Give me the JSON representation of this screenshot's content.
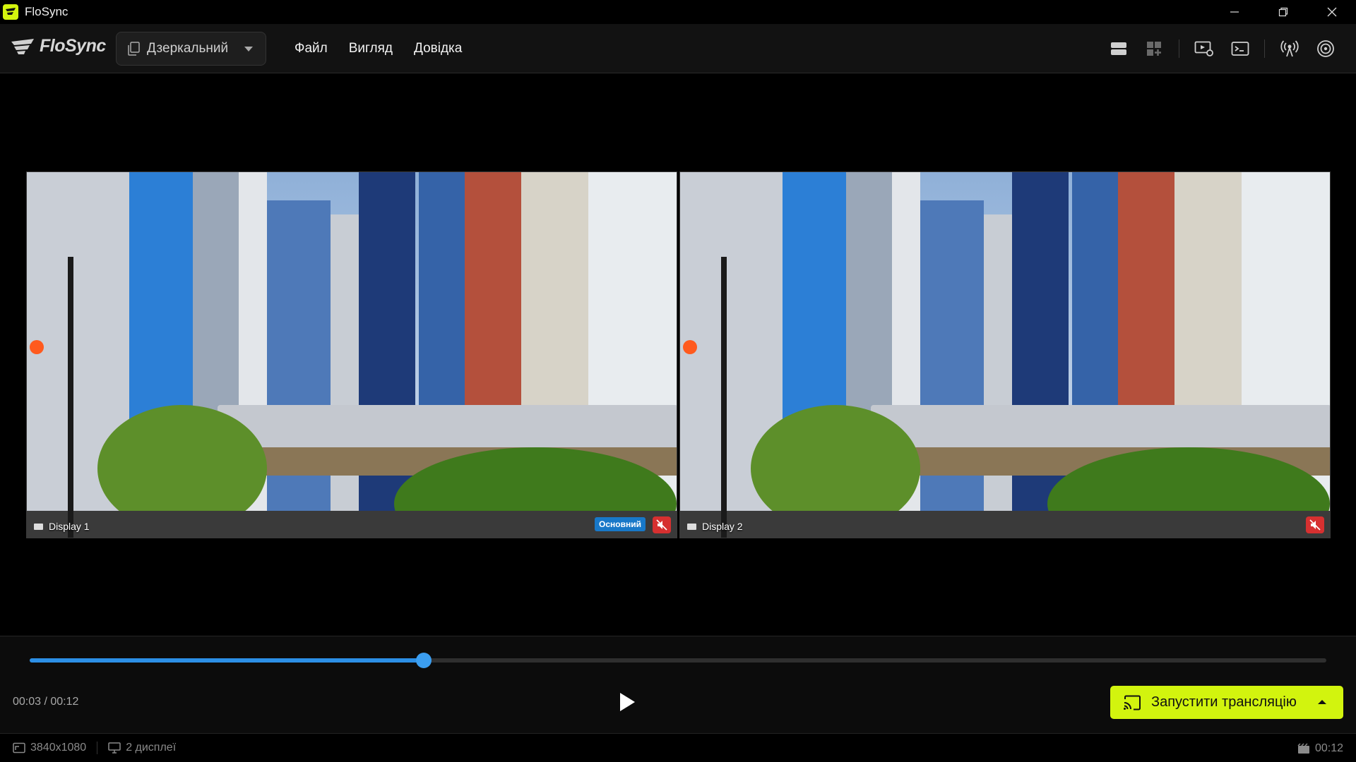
{
  "window": {
    "title": "FloSync"
  },
  "brand": {
    "logo_text": "FloSync",
    "accent": "#d4f40e"
  },
  "mode_select": {
    "value": "Дзеркальний"
  },
  "menu": {
    "items": [
      "Файл",
      "Вигляд",
      "Довідка"
    ]
  },
  "toolbar": {
    "icons": [
      "layout-rows-icon",
      "layout-grid-icon",
      "display-settings-icon",
      "terminal-icon",
      "broadcast-icon",
      "airplay-icon"
    ]
  },
  "displays": [
    {
      "label": "Display 1",
      "primary_badge": "Основний",
      "muted": true
    },
    {
      "label": "Display 2",
      "primary_badge": "",
      "muted": true
    }
  ],
  "playback": {
    "current": "00:03",
    "total": "00:12",
    "time_text": "00:03 / 00:12",
    "progress": 0.304
  },
  "cast_button": {
    "label": "Запустити трансляцію"
  },
  "status": {
    "resolution": "3840x1080",
    "displays": "2 дисплеї",
    "duration": "00:12"
  }
}
